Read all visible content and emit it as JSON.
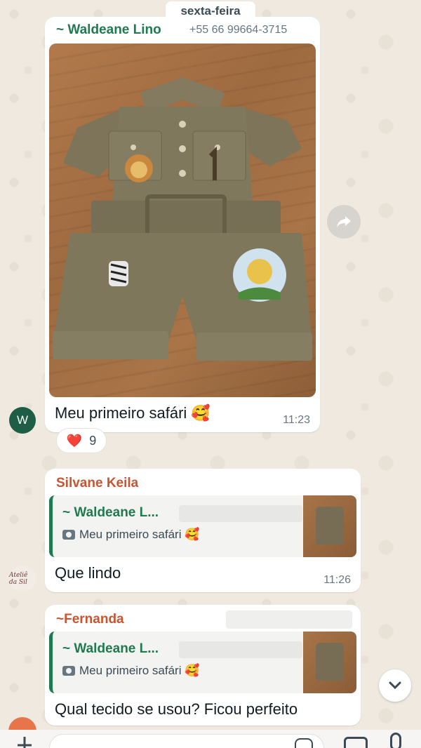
{
  "date_separator": "sexta-feira",
  "messages": [
    {
      "sender": "~ Waldeane Lino",
      "phone": "+55 66 99664-3715",
      "caption": "Meu primeiro safári 🥰",
      "time": "11:23",
      "avatar_letter": "W",
      "reaction": {
        "emoji": "❤️",
        "count": "9"
      }
    },
    {
      "sender": "Silvane Keila",
      "quoted_sender": "~ Waldeane L...",
      "quoted_text": "Meu primeiro safári 🥰",
      "body": "Que lindo",
      "time": "11:26",
      "avatar_text": "Ateliê da Sil"
    },
    {
      "sender": "~Fernanda",
      "quoted_sender": "~ Waldeane L...",
      "quoted_text": "Meu primeiro safári 🥰",
      "body": "Qual tecido se usou? Ficou perfeito"
    }
  ],
  "photo_description_icon": "safari-romper-photo",
  "colors": {
    "chat_bg": "#efeae2",
    "sender_green": "#1f7a4f",
    "sender_orange": "#c8552f",
    "avatar_green": "#1e5e46"
  }
}
